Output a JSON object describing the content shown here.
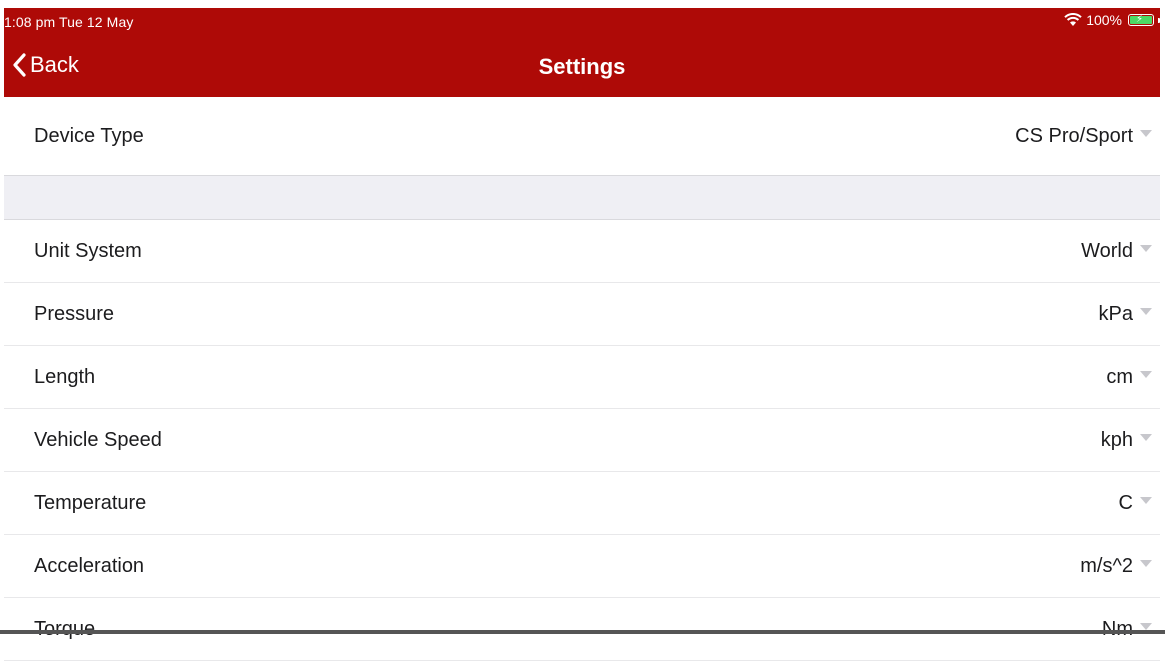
{
  "status_bar": {
    "time": "1:08 pm  Tue 12 May",
    "battery": "100%"
  },
  "nav": {
    "back_label": "Back",
    "title": "Settings"
  },
  "device": {
    "label": "Device Type",
    "value": "CS Pro/Sport"
  },
  "settings": [
    {
      "label": "Unit System",
      "value": "World"
    },
    {
      "label": "Pressure",
      "value": "kPa"
    },
    {
      "label": "Length",
      "value": "cm"
    },
    {
      "label": "Vehicle Speed",
      "value": "kph"
    },
    {
      "label": "Temperature",
      "value": "C"
    },
    {
      "label": "Acceleration",
      "value": "m/s^2"
    },
    {
      "label": "Torque",
      "value": "Nm"
    }
  ],
  "colors": {
    "header": "#ae0a07",
    "section_gap": "#efeff4",
    "battery": "#4cd964"
  }
}
